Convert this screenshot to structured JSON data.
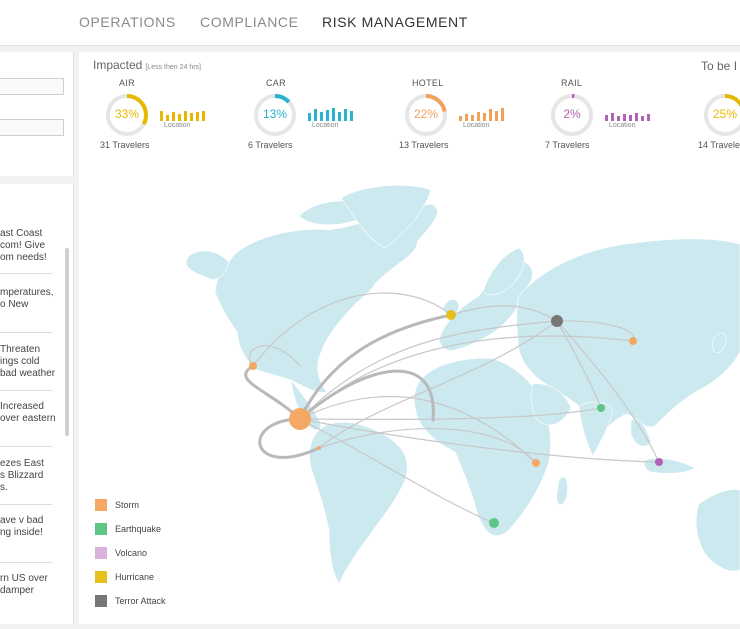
{
  "nav": {
    "tabs": [
      {
        "label": "OPERATIONS"
      },
      {
        "label": "COMPLIANCE"
      },
      {
        "label": "RISK MANAGEMENT"
      }
    ]
  },
  "impacted": {
    "title": "Impacted",
    "subtitle": "[Less then 24 hrs]",
    "to_be_title": "To be I",
    "categories": [
      {
        "label": "AIR",
        "percent": "33%",
        "percent_value": 33,
        "travelers": "31 Travelers",
        "location_label": "Location",
        "color": "#e6b800",
        "bars": [
          10,
          6,
          9,
          7,
          10,
          8,
          9,
          10
        ]
      },
      {
        "label": "CAR",
        "percent": "13%",
        "percent_value": 13,
        "travelers": "6 Travelers",
        "location_label": "Location",
        "color": "#2ab3cc",
        "bars": [
          8,
          12,
          9,
          11,
          13,
          9,
          12,
          10
        ]
      },
      {
        "label": "HOTEL",
        "percent": "22%",
        "percent_value": 22,
        "travelers": "13 Travelers",
        "location_label": "Location",
        "color": "#f0a15a",
        "bars": [
          5,
          7,
          6,
          9,
          8,
          12,
          10,
          13
        ]
      },
      {
        "label": "RAIL",
        "percent": "2%",
        "percent_value": 2,
        "travelers": "7 Travelers",
        "location_label": "Location",
        "color": "#b062b4",
        "bars": [
          6,
          8,
          5,
          7,
          6,
          8,
          5,
          7
        ]
      },
      {
        "label": "",
        "percent": "25%",
        "percent_value": 25,
        "travelers": "14 Travele",
        "location_label": "",
        "color": "#e6b800",
        "bars": []
      }
    ]
  },
  "news": [
    "ast Coast\ncom! Give\nom needs!",
    "mperatures,\no New",
    "Threaten\nings cold\nbad weather",
    "Increased\nover eastern",
    "ezes East\ns Blizzard\ns.",
    "ave v bad\nng inside!",
    "rn US over\ndamper"
  ],
  "legend": [
    {
      "label": "Storm",
      "color": "#f5a766"
    },
    {
      "label": "Earthquake",
      "color": "#5fc584"
    },
    {
      "label": "Volcano",
      "color": "#d9b3dc"
    },
    {
      "label": "Hurricane",
      "color": "#e6c01e"
    },
    {
      "label": "Terror Attack",
      "color": "#777777"
    }
  ],
  "colors": {
    "map_land": "#cce9f0",
    "route_line": "#c8c8c8"
  }
}
